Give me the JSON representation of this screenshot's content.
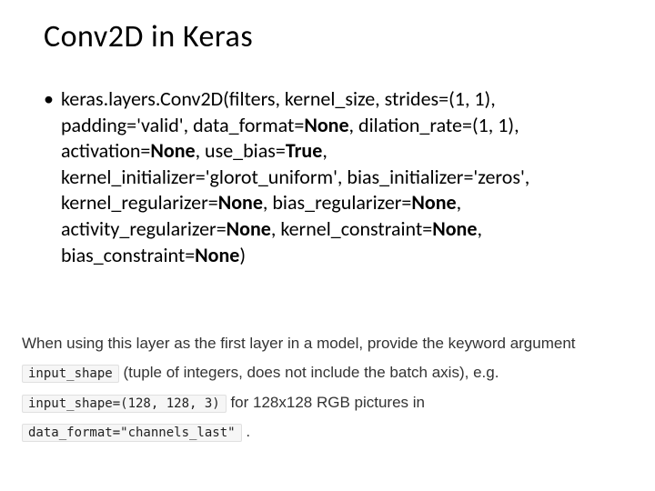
{
  "slide": {
    "title": "Conv2D in Keras",
    "bullet_prefix": "keras.layers.Conv2D(filters, kernel_size, strides=(1, 1), padding='valid', data_format=",
    "kw_none1": "None",
    "seg2": ", dilation_rate=(1, 1), activation=",
    "kw_none2": "None",
    "seg3": ", use_bias=",
    "kw_true": "True",
    "seg4": ", kernel_initializer='glorot_uniform', bias_initializer='zeros', kernel_regularizer=",
    "kw_none3": "None",
    "seg5": ", bias_regularizer=",
    "kw_none4": "None",
    "seg6": ", activity_regularizer=",
    "kw_none5": "None",
    "seg7": ", kernel_constraint=",
    "kw_none6": "None",
    "seg8": ", bias_constraint=",
    "kw_none7": "None",
    "seg9": ")"
  },
  "note": {
    "p1": "When using this layer as the first layer in a model, provide the keyword argument ",
    "code1": "input_shape",
    "p2": " (tuple of integers, does not include the batch axis), e.g. ",
    "code2": "input_shape=(128, 128, 3)",
    "p3": " for 128x128 RGB pictures in ",
    "code3": "data_format=\"channels_last\"",
    "p4": "."
  }
}
